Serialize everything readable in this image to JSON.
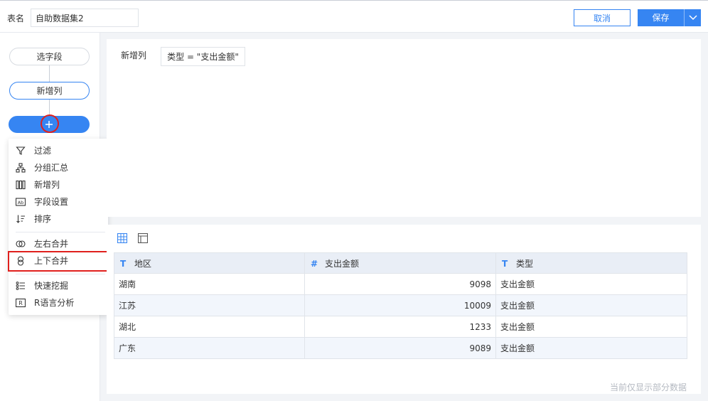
{
  "header": {
    "table_name_label": "表名",
    "table_name_value": "自助数据集2",
    "cancel_label": "取消",
    "save_label": "保存"
  },
  "steps": {
    "select_fields": "选字段",
    "new_column": "新增列"
  },
  "add_menu": {
    "items": [
      {
        "label": "过滤",
        "icon": "filter-icon"
      },
      {
        "label": "分组汇总",
        "icon": "group-summary-icon"
      },
      {
        "label": "新增列",
        "icon": "new-column-icon"
      },
      {
        "label": "字段设置",
        "icon": "field-settings-icon"
      },
      {
        "label": "排序",
        "icon": "sort-icon"
      },
      {
        "label": "左右合并",
        "icon": "horizontal-merge-icon"
      },
      {
        "label": "上下合并",
        "icon": "vertical-merge-icon"
      },
      {
        "label": "快速挖掘",
        "icon": "quick-mining-icon"
      },
      {
        "label": "R语言分析",
        "icon": "r-analysis-icon"
      }
    ]
  },
  "formula": {
    "label": "新增列",
    "expression": "类型 = \"支出金额\""
  },
  "table": {
    "columns": [
      {
        "type_icon": "T",
        "name": "地区"
      },
      {
        "type_icon": "#",
        "name": "支出金额"
      },
      {
        "type_icon": "T",
        "name": "类型"
      }
    ],
    "rows": [
      [
        "湖南",
        "9098",
        "支出金额"
      ],
      [
        "江苏",
        "10009",
        "支出金额"
      ],
      [
        "湖北",
        "1233",
        "支出金额"
      ],
      [
        "广东",
        "9089",
        "支出金额"
      ]
    ],
    "footnote": "当前仅显示部分数据"
  },
  "colors": {
    "accent": "#3685f2",
    "highlight": "#e0201d"
  }
}
